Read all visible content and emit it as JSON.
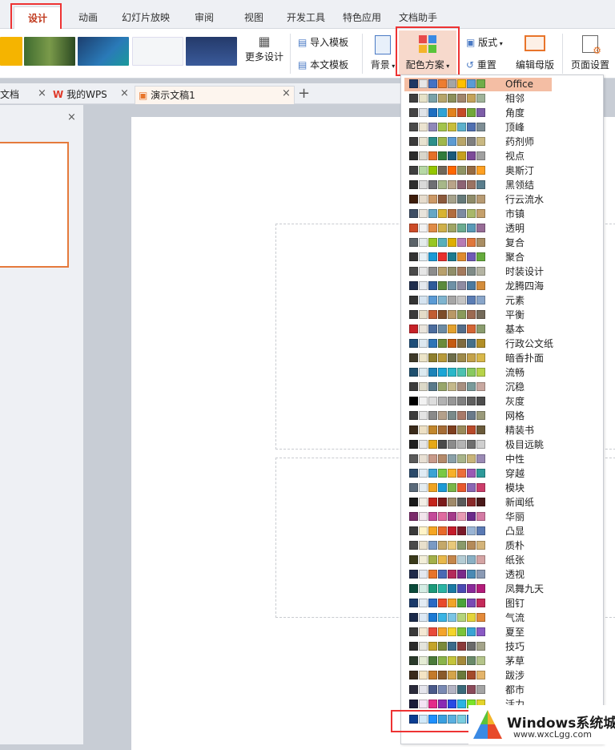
{
  "menu": {
    "tabs": [
      "设计",
      "动画",
      "幻灯片放映",
      "审阅",
      "视图",
      "开发工具",
      "特色应用",
      "文档助手"
    ]
  },
  "ribbon": {
    "more_design": "更多设计",
    "import_template": "导入模板",
    "text_template": "本文模板",
    "background": "背景",
    "color_scheme": "配色方案",
    "layout": "版式",
    "reset": "重置",
    "edit_master": "编辑母版",
    "page_setup": "页面设置"
  },
  "doc_tabs": {
    "t1": "文档",
    "t2": "我的WPS",
    "t3": "演示文稿1",
    "new_tab": "+"
  },
  "color_schemes": [
    {
      "name": "Office",
      "colors": [
        "#1f3864",
        "#e7e6e6",
        "#4472c4",
        "#ed7d31",
        "#a5a5a5",
        "#ffc000",
        "#5b9bd5",
        "#70ad47"
      ]
    },
    {
      "name": "相邻",
      "colors": [
        "#3f3f3f",
        "#e6e2c8",
        "#7aa2a8",
        "#b6a56a",
        "#8c8f5a",
        "#a1856c",
        "#c4a35a",
        "#9fb39a"
      ]
    },
    {
      "name": "角度",
      "colors": [
        "#444444",
        "#dfe3e8",
        "#1e6ec0",
        "#2fa3d6",
        "#e2821d",
        "#c64b28",
        "#72a839",
        "#7d5ea8"
      ]
    },
    {
      "name": "顶峰",
      "colors": [
        "#4a4a4a",
        "#ebe3d0",
        "#8f88b9",
        "#a3c44c",
        "#c7bd3a",
        "#5cb0cc",
        "#4f6fb0",
        "#7d8d94"
      ]
    },
    {
      "name": "药剂师",
      "colors": [
        "#3b3b3b",
        "#e8e3d0",
        "#2d8f8a",
        "#9fb74b",
        "#5d9bd2",
        "#b9a66a",
        "#7f7f7f",
        "#c9b882"
      ]
    },
    {
      "name": "视点",
      "colors": [
        "#2a2a2a",
        "#d9d6cb",
        "#e57027",
        "#2f7b3b",
        "#1b5a7a",
        "#c69f1f",
        "#7c4a98",
        "#a0a0a0"
      ]
    },
    {
      "name": "奥斯汀",
      "colors": [
        "#3f3f3f",
        "#b6d8a5",
        "#94c600",
        "#71685a",
        "#ff6700",
        "#909465",
        "#956b43",
        "#fea022"
      ]
    },
    {
      "name": "黑领结",
      "colors": [
        "#2e2e2e",
        "#d9d9d9",
        "#6f6f74",
        "#a7b789",
        "#b9a489",
        "#8d6374",
        "#9b7362",
        "#5a7e8d"
      ]
    },
    {
      "name": "行云流水",
      "colors": [
        "#3d1c0a",
        "#e6dccd",
        "#cc9966",
        "#8c5a3c",
        "#a6a28b",
        "#657a7a",
        "#8f8c6a",
        "#b79b73"
      ]
    },
    {
      "name": "市镇",
      "colors": [
        "#3d4d64",
        "#e8e4dc",
        "#66a7c5",
        "#d8b432",
        "#b26d3f",
        "#7d8ba1",
        "#a9b86a",
        "#c5a06b"
      ]
    },
    {
      "name": "透明",
      "colors": [
        "#cc4b28",
        "#f2f2f2",
        "#e08c47",
        "#cfb049",
        "#9fa464",
        "#6bab90",
        "#5a99b7",
        "#976c96"
      ]
    },
    {
      "name": "复合",
      "colors": [
        "#5b6369",
        "#e4ecec",
        "#98c723",
        "#59b0b9",
        "#deae00",
        "#b77bb4",
        "#e0773c",
        "#a98d63"
      ]
    },
    {
      "name": "聚合",
      "colors": [
        "#333333",
        "#e7f0f5",
        "#1c9ad6",
        "#e8302c",
        "#1d7a8e",
        "#e08b2e",
        "#6f5ab5",
        "#65ab3c"
      ]
    },
    {
      "name": "时装设计",
      "colors": [
        "#4a4a4a",
        "#e6e6e6",
        "#8c8c8c",
        "#b8a06c",
        "#908e69",
        "#a47a5d",
        "#7f8b87",
        "#b4b4a3"
      ]
    },
    {
      "name": "龙腾四海",
      "colors": [
        "#1f2d4d",
        "#e4e8ee",
        "#2e5b9a",
        "#5a8a3c",
        "#6e91a6",
        "#8f8ca2",
        "#4b7a9f",
        "#d48d3b"
      ]
    },
    {
      "name": "元素",
      "colors": [
        "#333333",
        "#d6e4f0",
        "#5b9bd5",
        "#7fb4cf",
        "#a6a6a6",
        "#c4c4c4",
        "#5b7db4",
        "#89a5c9"
      ]
    },
    {
      "name": "平衡",
      "colors": [
        "#3a3a3a",
        "#e4dcc8",
        "#c15d33",
        "#7d4d2a",
        "#b99866",
        "#8a9a5a",
        "#9c6a52",
        "#746a5a"
      ]
    },
    {
      "name": "基本",
      "colors": [
        "#c62127",
        "#e9e4dc",
        "#4c6d9e",
        "#6c8ba3",
        "#e3a12e",
        "#546e8a",
        "#d36534",
        "#8a9c6e"
      ]
    },
    {
      "name": "行政公文纸",
      "colors": [
        "#1f4e79",
        "#dde8f0",
        "#2e75b6",
        "#6c8b3a",
        "#c55a11",
        "#7f6b3f",
        "#46708a",
        "#b28f27"
      ]
    },
    {
      "name": "暗香扑面",
      "colors": [
        "#3f3a2a",
        "#ece4c8",
        "#8f7f2e",
        "#b89a3a",
        "#6d6d4a",
        "#9e8a4a",
        "#c4a24a",
        "#d9b84a"
      ]
    },
    {
      "name": "流畅",
      "colors": [
        "#1e4f6e",
        "#dceaf0",
        "#1c83b8",
        "#1aa6d6",
        "#29b7c9",
        "#4cc2b0",
        "#88c960",
        "#b7d34a"
      ]
    },
    {
      "name": "沉稳",
      "colors": [
        "#3c3c3c",
        "#dcd9c8",
        "#5a7a8a",
        "#98a66a",
        "#c4b88a",
        "#a89080",
        "#7a9a9a",
        "#c8a8a0"
      ]
    },
    {
      "name": "灰度",
      "colors": [
        "#000000",
        "#f2f2f2",
        "#dddddd",
        "#b2b2b2",
        "#969696",
        "#808080",
        "#5f5f5f",
        "#4d4d4d"
      ]
    },
    {
      "name": "网格",
      "colors": [
        "#3c3c3c",
        "#e4e4e4",
        "#8a8a8a",
        "#b4a08a",
        "#7a8a8a",
        "#a87a6a",
        "#6a7a8a",
        "#9a9a7a"
      ]
    },
    {
      "name": "精装书",
      "colors": [
        "#3a2a1a",
        "#ede0c4",
        "#c2872d",
        "#a66c35",
        "#7f3f1f",
        "#9a8a5a",
        "#b84a2a",
        "#6a5a3a"
      ]
    },
    {
      "name": "极目远眺",
      "colors": [
        "#1f1f1f",
        "#e6e6e6",
        "#e6a817",
        "#4a4a4a",
        "#8c8c8c",
        "#b4b4b4",
        "#6f6f6f",
        "#cfcfcf"
      ]
    },
    {
      "name": "中性",
      "colors": [
        "#5a5a5a",
        "#e8e0d4",
        "#c89a8a",
        "#b48a6a",
        "#8aa0a8",
        "#a8b48a",
        "#c8b47a",
        "#9a8ab4"
      ]
    },
    {
      "name": "穿越",
      "colors": [
        "#2a4a6a",
        "#e0ecf4",
        "#3aa3d4",
        "#7ac943",
        "#f7b12a",
        "#ec6e3b",
        "#9a5ab4",
        "#2e9a9a"
      ]
    },
    {
      "name": "模块",
      "colors": [
        "#5a6a7a",
        "#e4ecf0",
        "#f0a422",
        "#1c9ad6",
        "#7ab648",
        "#e8582e",
        "#8a66b4",
        "#cc3d6a"
      ]
    },
    {
      "name": "新闻纸",
      "colors": [
        "#1a1a1a",
        "#f2eee6",
        "#c4241c",
        "#7a1a1a",
        "#a08a6a",
        "#5a5a5a",
        "#8a2a2a",
        "#4a1a1a"
      ]
    },
    {
      "name": "华丽",
      "colors": [
        "#7a2a6a",
        "#f2e4ec",
        "#c44a9a",
        "#e06aa0",
        "#a43a8a",
        "#e89ab4",
        "#6a2a8a",
        "#d47aa4"
      ]
    },
    {
      "name": "凸显",
      "colors": [
        "#3a3a3a",
        "#fff4c8",
        "#f5a623",
        "#e86a2a",
        "#c41c2a",
        "#7a1a2a",
        "#9ab4d4",
        "#5a7ab4"
      ]
    },
    {
      "name": "质朴",
      "colors": [
        "#4a4a4a",
        "#e8e0cc",
        "#7a9ac4",
        "#c4a86a",
        "#e8c87a",
        "#8a9a6a",
        "#b48a5a",
        "#d4b47a"
      ]
    },
    {
      "name": "纸张",
      "colors": [
        "#3a3a1a",
        "#f2eed8",
        "#a4b04a",
        "#e8b84a",
        "#c4864a",
        "#b4ccd4",
        "#8ab0c4",
        "#d4a4a4"
      ]
    },
    {
      "name": "透视",
      "colors": [
        "#1f2a4a",
        "#e4e8f0",
        "#e8742a",
        "#4a6ab4",
        "#b42a5a",
        "#7a2a8a",
        "#4a8ab4",
        "#8a9ab4"
      ]
    },
    {
      "name": "凤舞九天",
      "colors": [
        "#0a4a3a",
        "#d4ece4",
        "#1c9a7a",
        "#2ab4a4",
        "#1a7aa4",
        "#4a4ab4",
        "#8a2a9a",
        "#b41c7a"
      ]
    },
    {
      "name": "图钉",
      "colors": [
        "#1a3a6a",
        "#e4ecf4",
        "#2a6ac4",
        "#e84a2a",
        "#f0a428",
        "#4aa43a",
        "#7a4ab4",
        "#c42a5a"
      ]
    },
    {
      "name": "气流",
      "colors": [
        "#1a2a4a",
        "#dce8f4",
        "#1c7ad4",
        "#3ab4e4",
        "#7ac4e4",
        "#b4d47a",
        "#e4d43a",
        "#e48a3a"
      ]
    },
    {
      "name": "夏至",
      "colors": [
        "#3a3a3a",
        "#f4e8d4",
        "#e84a3a",
        "#f4a42a",
        "#f4d42a",
        "#7ac43a",
        "#3aa4d4",
        "#8a5ac4"
      ]
    },
    {
      "name": "技巧",
      "colors": [
        "#2a2a2a",
        "#e4e4dc",
        "#c4a42a",
        "#7a8a3a",
        "#3a6a8a",
        "#8a3a3a",
        "#6a6a6a",
        "#a4a48a"
      ]
    },
    {
      "name": "茅草",
      "colors": [
        "#2a3a2a",
        "#e4ecd4",
        "#4a7a3a",
        "#8ab44a",
        "#c4c43a",
        "#a48a3a",
        "#6a8a6a",
        "#b4c48a"
      ]
    },
    {
      "name": "跋涉",
      "colors": [
        "#3a2a1a",
        "#f4e4c4",
        "#c47a2a",
        "#8a5a2a",
        "#d4a44a",
        "#6a7a3a",
        "#a44a2a",
        "#e4b46a"
      ]
    },
    {
      "name": "都市",
      "colors": [
        "#2a2a3a",
        "#e4e4ec",
        "#4a5a8a",
        "#7a8ab4",
        "#b4b4c4",
        "#3a6a7a",
        "#8a4a5a",
        "#a4a4a4"
      ]
    },
    {
      "name": "活力",
      "colors": [
        "#1a1a3a",
        "#f4e4f4",
        "#e42a8a",
        "#8a2ab4",
        "#2a4ae4",
        "#2ab4e4",
        "#7ae42a",
        "#e4d42a"
      ]
    }
  ],
  "footer_colors": [
    "#0b3d91",
    "#d0e8f8",
    "#1e90ff",
    "#3aa0e0",
    "#5ab0e0",
    "#7acde0",
    "#2a7ad4",
    "#47a8e6"
  ],
  "watermark": {
    "brand": "Windows系统城",
    "url": "www.wxcLgg.com"
  }
}
